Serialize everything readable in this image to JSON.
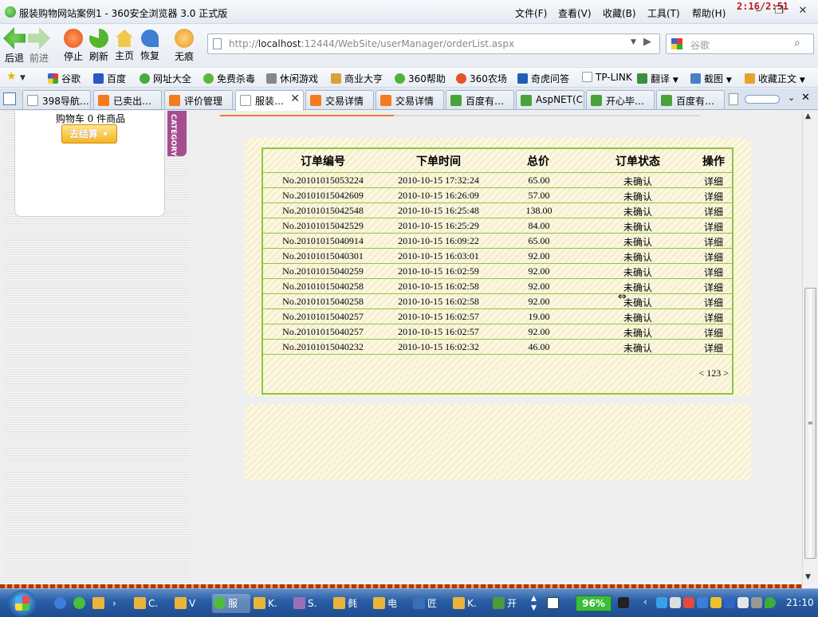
{
  "window": {
    "title": "服装购物网站案例1 - 360安全浏览器 3.0 正式版",
    "menus": [
      "文件(F)",
      "查看(V)",
      "收藏(B)",
      "工具(T)",
      "帮助(H)"
    ],
    "clock_overlay": "2:16/2:51"
  },
  "nav": {
    "buttons": [
      "后退",
      "前进",
      "停止",
      "刷新",
      "主页",
      "恢复",
      "无痕"
    ],
    "address_prefix": "http://",
    "address_host": "localhost",
    "address_rest": ":12444/WebSite/userManager/orderList.aspx",
    "search_placeholder": "谷歌"
  },
  "favorites": [
    "谷歌",
    "百度",
    "网址大全",
    "免费杀毒",
    "休闲游戏",
    "商业大亨",
    "360帮助",
    "360农场",
    "奇虎问答",
    "TP-LINK",
    "翻译",
    "截图",
    "收藏正文"
  ],
  "tabs": [
    {
      "label": "398导航…"
    },
    {
      "label": "已卖出…"
    },
    {
      "label": "评价管理"
    },
    {
      "label": "服装…",
      "active": true
    },
    {
      "label": "交易详情"
    },
    {
      "label": "交易详情"
    },
    {
      "label": "百度有…"
    },
    {
      "label": "AspNET(C"
    },
    {
      "label": "开心毕…"
    },
    {
      "label": "百度有…"
    }
  ],
  "sidebar": {
    "cart_text": "购物车  0 件商品",
    "checkout_label": "去结算",
    "category_label": "CATEGORY"
  },
  "orders": {
    "headers": [
      "订单编号",
      "下单时间",
      "总价",
      "订单状态",
      "操作"
    ],
    "rows": [
      {
        "id": "No.20101015053224",
        "time": "2010-10-15 17:32:24",
        "total": "65.00",
        "status": "未确认",
        "action": "详细"
      },
      {
        "id": "No.20101015042609",
        "time": "2010-10-15 16:26:09",
        "total": "57.00",
        "status": "未确认",
        "action": "详细"
      },
      {
        "id": "No.20101015042548",
        "time": "2010-10-15 16:25:48",
        "total": "138.00",
        "status": "未确认",
        "action": "详细"
      },
      {
        "id": "No.20101015042529",
        "time": "2010-10-15 16:25:29",
        "total": "84.00",
        "status": "未确认",
        "action": "详细"
      },
      {
        "id": "No.20101015040914",
        "time": "2010-10-15 16:09:22",
        "total": "65.00",
        "status": "未确认",
        "action": "详细"
      },
      {
        "id": "No.20101015040301",
        "time": "2010-10-15 16:03:01",
        "total": "92.00",
        "status": "未确认",
        "action": "详细"
      },
      {
        "id": "No.20101015040259",
        "time": "2010-10-15 16:02:59",
        "total": "92.00",
        "status": "未确认",
        "action": "详细"
      },
      {
        "id": "No.20101015040258",
        "time": "2010-10-15 16:02:58",
        "total": "92.00",
        "status": "未确认",
        "action": "详细"
      },
      {
        "id": "No.20101015040258",
        "time": "2010-10-15 16:02:58",
        "total": "92.00",
        "status": "未确认",
        "action": "详细"
      },
      {
        "id": "No.20101015040257",
        "time": "2010-10-15 16:02:57",
        "total": "19.00",
        "status": "未确认",
        "action": "详细"
      },
      {
        "id": "No.20101015040257",
        "time": "2010-10-15 16:02:57",
        "total": "92.00",
        "status": "未确认",
        "action": "详细"
      },
      {
        "id": "No.20101015040232",
        "time": "2010-10-15 16:02:32",
        "total": "46.00",
        "status": "未确认",
        "action": "详细"
      }
    ],
    "pager": {
      "prev": "<",
      "pages": "123",
      "next": ">"
    }
  },
  "taskbar": {
    "items": [
      "C.",
      "V",
      "服",
      "K.",
      "S.",
      "毵",
      "电",
      "匠",
      "K.",
      "开"
    ],
    "zoom": "96%",
    "time": "21:10"
  },
  "colors": {
    "table_border": "#8cc63f",
    "category_tab": "#a64d8f",
    "tab_underline": "#e77c3a"
  }
}
